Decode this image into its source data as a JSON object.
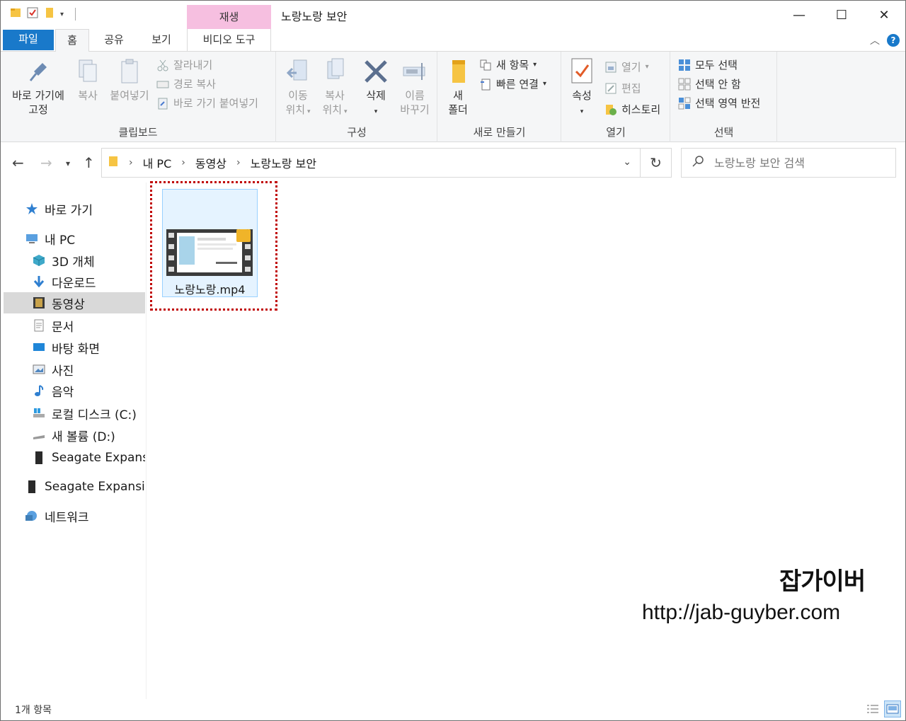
{
  "window": {
    "title": "노랑노랑 보안",
    "contextual_header": "재생",
    "controls": {
      "minimize": "—",
      "maximize": "☐",
      "close": "✕"
    }
  },
  "ribbon_tabs": {
    "file": "파일",
    "home": "홈",
    "share": "공유",
    "view": "보기",
    "video_tools": "비디오 도구"
  },
  "ribbon": {
    "clipboard": {
      "label": "클립보드",
      "pin_line1": "바로 가기에",
      "pin_line2": "고정",
      "copy": "복사",
      "paste": "붙여넣기",
      "cut": "잘라내기",
      "copy_path": "경로 복사",
      "paste_shortcut": "바로 가기 붙여넣기"
    },
    "organize": {
      "label": "구성",
      "move_line1": "이동",
      "move_line2": "위치",
      "copyto_line1": "복사",
      "copyto_line2": "위치",
      "delete": "삭제",
      "rename_line1": "이름",
      "rename_line2": "바꾸기"
    },
    "new": {
      "label": "새로 만들기",
      "folder_line1": "새",
      "folder_line2": "폴더",
      "new_item": "새 항목",
      "easy_access": "빠른 연결"
    },
    "open": {
      "label": "열기",
      "properties": "속성",
      "open": "열기",
      "edit": "편집",
      "history": "히스토리"
    },
    "select": {
      "label": "선택",
      "select_all": "모두 선택",
      "select_none": "선택 안 함",
      "invert": "선택 영역 반전"
    }
  },
  "address": {
    "crumbs": [
      "내 PC",
      "동영상",
      "노랑노랑 보안"
    ],
    "search_placeholder": "노랑노랑 보안 검색"
  },
  "nav_pane": {
    "quick_access": "바로 가기",
    "this_pc": "내 PC",
    "objects3d": "3D 개체",
    "downloads": "다운로드",
    "videos": "동영상",
    "documents": "문서",
    "desktop": "바탕 화면",
    "pictures": "사진",
    "music": "음악",
    "local_disk": "로컬 디스크 (C:)",
    "new_volume": "새 볼륨 (D:)",
    "seagate1": "Seagate Expansion",
    "seagate2": "Seagate Expansion",
    "network": "네트워크"
  },
  "files": [
    {
      "name": "노랑노랑.mp4"
    }
  ],
  "watermark": {
    "title": "잡가이버",
    "url": "http://jab-guyber.com"
  },
  "status": {
    "count": "1개 항목"
  },
  "colors": {
    "accent": "#1979ca",
    "contextual": "#f6bfe0",
    "selection": "#d9d9d9",
    "highlight_border": "#c00000"
  }
}
